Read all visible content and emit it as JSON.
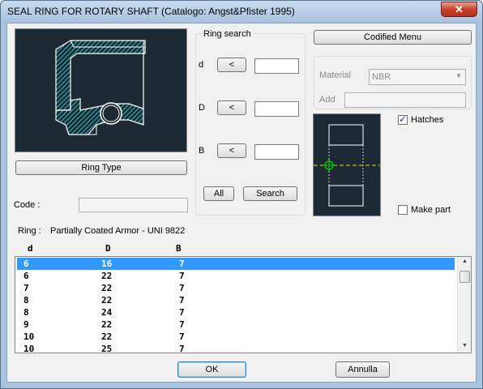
{
  "window": {
    "title": "SEAL RING FOR ROTARY SHAFT (Catalogo: Angst&Pfister 1995)",
    "close_glyph": "✕"
  },
  "ring_type_button": "Ring Type",
  "code": {
    "label": "Code   :",
    "value": ""
  },
  "ring_search": {
    "title": "Ring search",
    "rows": [
      {
        "label": "d",
        "button": "<",
        "value": ""
      },
      {
        "label": "D",
        "button": "<",
        "value": ""
      },
      {
        "label": "B",
        "button": "<",
        "value": ""
      }
    ],
    "all_button": "All",
    "search_button": "Search"
  },
  "codified_menu_button": "Codified Menu",
  "material": {
    "label": "Material",
    "value": "NBR"
  },
  "add": {
    "label": "Add",
    "value": ""
  },
  "hatches": {
    "label": "Hatches",
    "checked": true
  },
  "make_part": {
    "label": "Make part",
    "checked": false
  },
  "ring_info": {
    "label": "Ring :",
    "value": "Partially Coated Armor - UNI 9822"
  },
  "table": {
    "headers": [
      "d",
      "D",
      "B"
    ],
    "rows": [
      [
        "6",
        "16",
        "7"
      ],
      [
        "6",
        "22",
        "7"
      ],
      [
        "7",
        "22",
        "7"
      ],
      [
        "8",
        "22",
        "7"
      ],
      [
        "8",
        "24",
        "7"
      ],
      [
        "9",
        "22",
        "7"
      ],
      [
        "10",
        "22",
        "7"
      ],
      [
        "10",
        "25",
        "7"
      ]
    ],
    "selected_index": 0
  },
  "ok_button": "OK",
  "cancel_button": "Annulla",
  "colors": {
    "preview_bg": "#1e2a33",
    "section_cyan": "#2ec4c4",
    "axis_yellow": "#e8e000",
    "marker_green": "#00e000",
    "selection": "#3399ff"
  }
}
